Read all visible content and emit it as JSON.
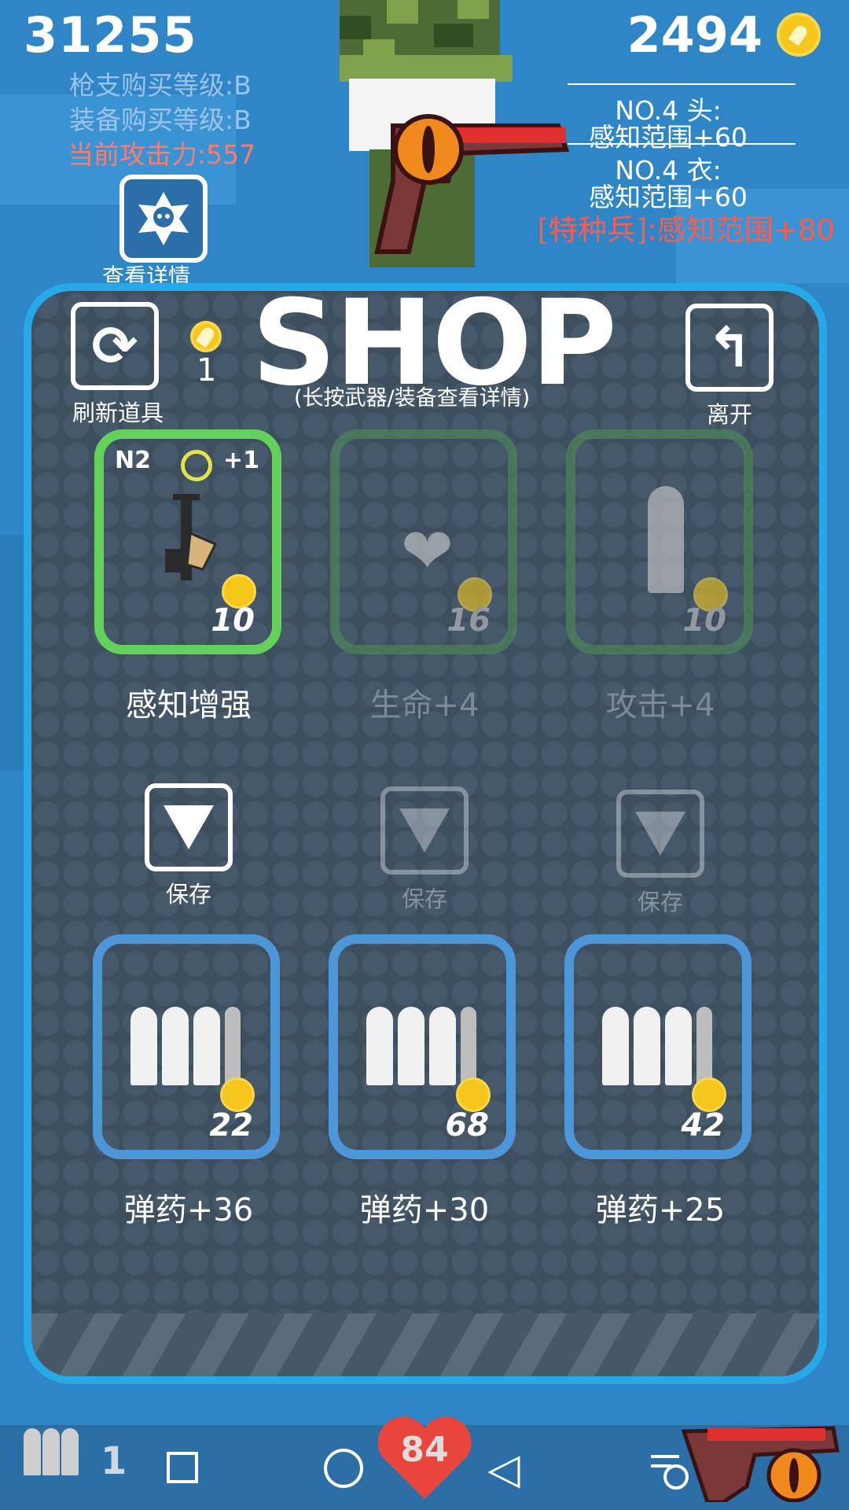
{
  "hud": {
    "score": "31255",
    "coins": "2494",
    "gun_level": "枪支购买等级:B",
    "gear_level": "装备购买等级:B",
    "attack": "当前攻击力:557",
    "details_label": "查看详情",
    "head_gear_title": "NO.4 头:",
    "head_gear_bonus": "感知范围+60",
    "body_gear_title": "NO.4 衣:",
    "body_gear_bonus": "感知范围+60",
    "special_bonus": "[特种兵]:感知范围+80"
  },
  "shop": {
    "title": "SHOP",
    "subtitle": "(长按武器/装备查看详情)",
    "refresh_label": "刷新道具",
    "refresh_cost": "1",
    "exit_label": "离开",
    "top_items": [
      {
        "tag": "N2",
        "bonus": "+1",
        "price": "10",
        "label": "感知增强",
        "icon": "rifle-icon",
        "enabled": true
      },
      {
        "price": "16",
        "label": "生命+4",
        "icon": "heart-icon",
        "enabled": false
      },
      {
        "price": "10",
        "label": "攻击+4",
        "icon": "bullet-icon",
        "enabled": false
      }
    ],
    "save_label": "保存",
    "ammo_items": [
      {
        "price": "22",
        "label": "弹药+36",
        "icon": "ammo-icon"
      },
      {
        "price": "68",
        "label": "弹药+30",
        "icon": "ammo-icon"
      },
      {
        "price": "42",
        "label": "弹药+25",
        "icon": "ammo-icon"
      }
    ]
  },
  "bottom": {
    "ammo_count": "1",
    "health": "84"
  },
  "colors": {
    "panel_border": "#27a9e8",
    "green_card": "#64d25a",
    "blue_card": "#4d97d8",
    "coin": "#f5c71a",
    "attack_text": "#ff7b6b",
    "special_text": "#ff5a4a"
  }
}
